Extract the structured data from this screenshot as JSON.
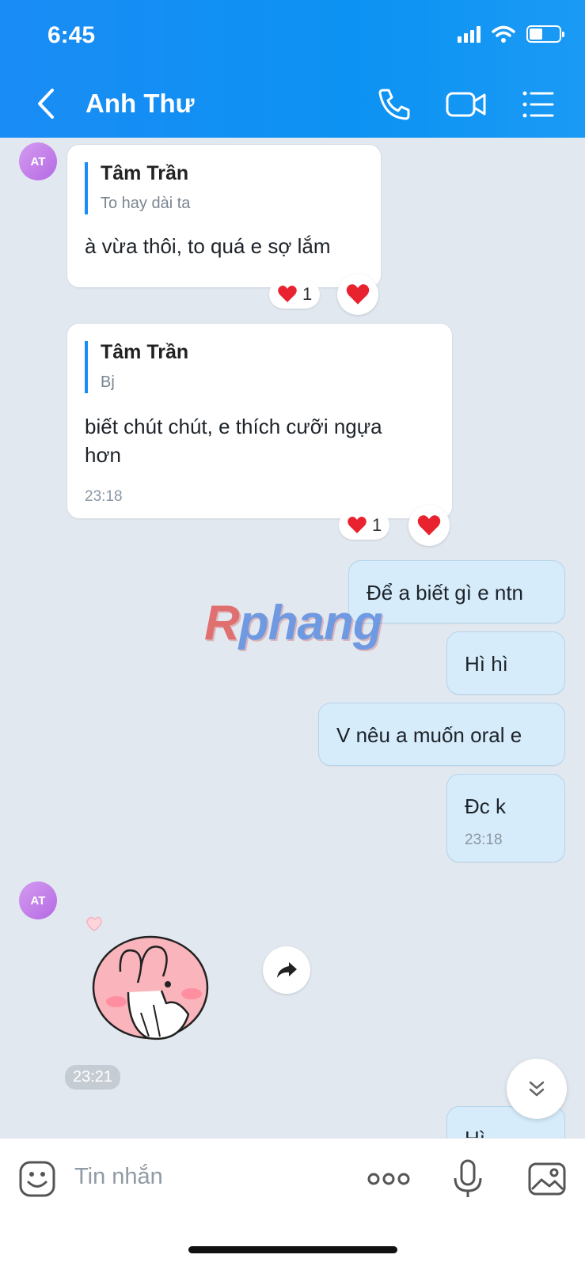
{
  "status_bar": {
    "time": "6:45"
  },
  "header": {
    "contact_name": "Anh Thư"
  },
  "avatar_initials": "AT",
  "messages": {
    "m1": {
      "quote_name": "Tâm Trần",
      "quote_text": "To hay dài ta",
      "text": "à vừa thôi, to quá e sợ lắm",
      "reaction_count": "1"
    },
    "m2": {
      "quote_name": "Tâm Trần",
      "quote_text": "Bj",
      "text_line1": "biết chút chút, e thích cưỡi ngựa",
      "text_line2": "hơn",
      "time": "23:18",
      "reaction_count": "1"
    },
    "m3": {
      "text": "Để a biết gì e ntn"
    },
    "m4": {
      "text": "Hì hì"
    },
    "m5": {
      "text": "V nêu a muốn oral e"
    },
    "m6": {
      "text": "Đc k",
      "time": "23:18"
    },
    "sticker": {
      "time": "23:21"
    },
    "m7": {
      "text": "Hì"
    }
  },
  "watermark": {
    "first": "R",
    "rest": "phang"
  },
  "input": {
    "placeholder": "Tin nhắn"
  },
  "colors": {
    "header_blue": "#1a8cf5",
    "outgoing_bubble": "#d6ecfb",
    "heart": "#e8232f",
    "background": "#e2e8f0"
  },
  "icons": [
    "back-arrow-icon",
    "phone-icon",
    "video-call-icon",
    "menu-list-icon",
    "heart-icon",
    "forward-icon",
    "chevron-double-down-icon",
    "sticker-emoji-icon",
    "more-icon",
    "microphone-icon",
    "image-icon"
  ]
}
